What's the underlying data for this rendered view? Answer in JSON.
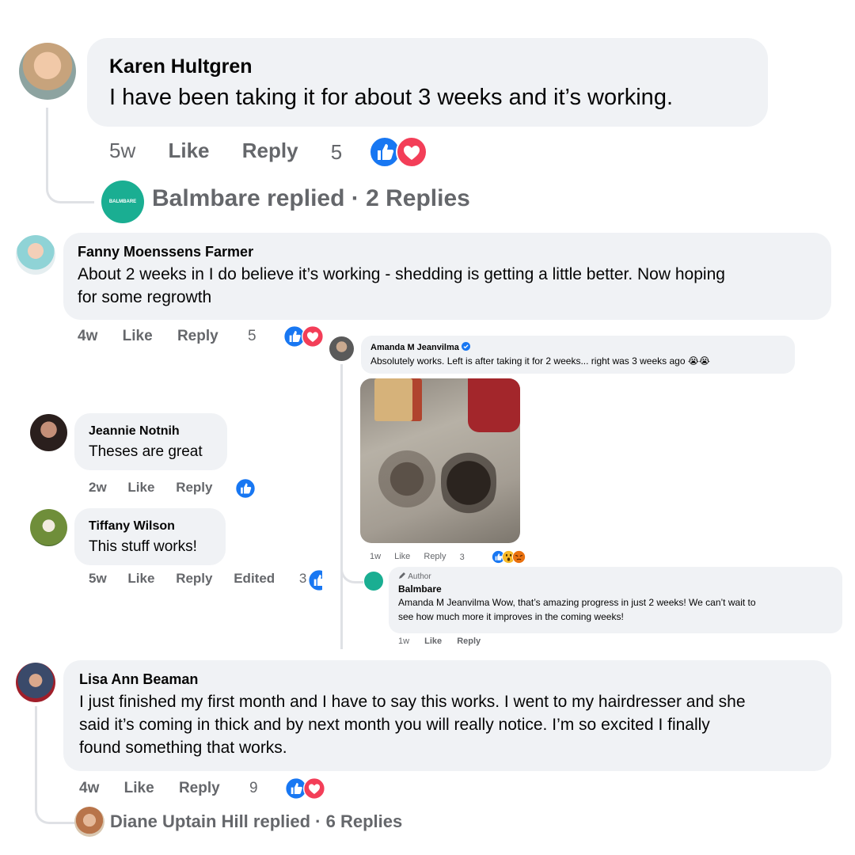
{
  "comments": [
    {
      "author": "Karen Hultgren",
      "text": "I have been taking it for about 3 weeks and it’s working.",
      "time": "5w",
      "like": "Like",
      "reply": "Reply",
      "reaction_count": "5",
      "replies_summary": {
        "author": "Balmbare replied",
        "count": "· 2 Replies",
        "avatar_text": "BALMBARE"
      }
    },
    {
      "author": "Fanny Moenssens Farmer",
      "text_line1": "About 2 weeks in I do believe it’s working - shedding is getting a little better. Now hoping",
      "text_line2": "for some regrowth",
      "time": "4w",
      "like": "Like",
      "reply": "Reply",
      "reaction_count": "5"
    },
    {
      "author": "Jeannie Notnih",
      "text": "Theses are great",
      "time": "2w",
      "like": "Like",
      "reply": "Reply"
    },
    {
      "author": "Tiffany Wilson",
      "text": "This stuff works!",
      "time": "5w",
      "like": "Like",
      "reply": "Reply",
      "edited": "Edited",
      "reaction_count": "3"
    },
    {
      "author": "Amanda M Jeanvilma",
      "verified": true,
      "text": "Absolutely works. Left is after taking it for 2 weeks... right was 3 weeks ago 😭😭",
      "time": "1w",
      "like": "Like",
      "reply": "Reply",
      "reaction_count": "3"
    },
    {
      "author_badge": "Author",
      "author": "Balmbare",
      "text_line1": "Amanda M Jeanvilma Wow, that’s amazing progress in just 2 weeks! We can’t wait to",
      "text_line2": "see how much more it improves in the coming weeks!",
      "time": "1w",
      "like": "Like",
      "reply": "Reply"
    },
    {
      "author": "Lisa Ann Beaman",
      "text_line1": "I just finished my first month and I have to say this works. I went to my hairdresser and she",
      "text_line2": "said it’s coming in thick and by next month you will really notice. I’m so excited I finally",
      "text_line3": "found something that works.",
      "time": "4w",
      "like": "Like",
      "reply": "Reply",
      "reaction_count": "9",
      "replies_summary": {
        "author": "Diane Uptain Hill replied",
        "count": "· 6 Replies"
      }
    }
  ],
  "colors": {
    "like_blue": "#1877f2",
    "love_red": "#f33e58",
    "bubble_gray": "#f0f2f5",
    "meta_gray": "#65676b",
    "balmbare_teal": "#1aae92"
  },
  "icons": [
    "like-icon",
    "love-icon",
    "wow-icon",
    "angry-icon",
    "verified-icon",
    "pencil-icon"
  ]
}
